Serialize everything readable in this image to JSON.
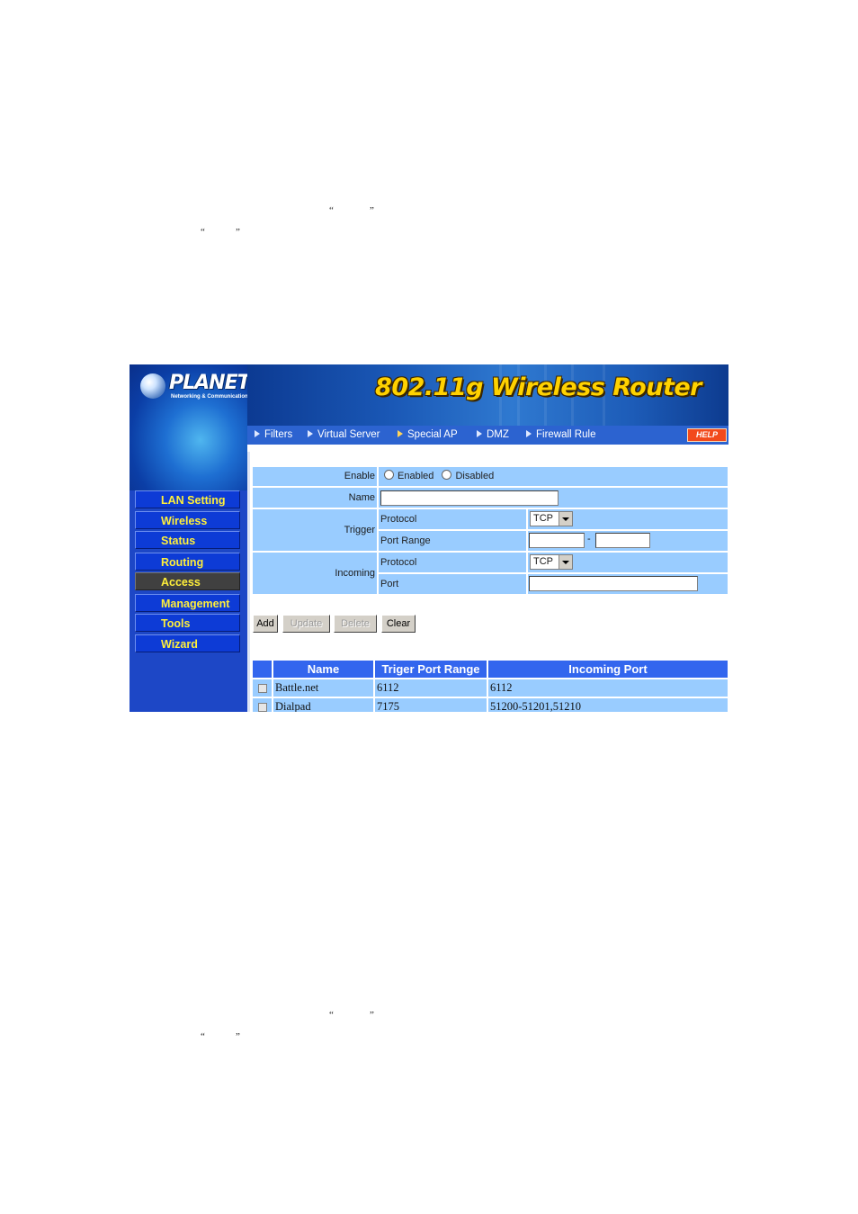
{
  "doc": {
    "quote_pairs": [
      {
        "open": "“",
        "close": "”"
      },
      {
        "open": "“",
        "close": "”"
      },
      {
        "open": "“",
        "close": "”"
      },
      {
        "open": "“",
        "close": "”"
      }
    ]
  },
  "header": {
    "logo_text": "PLANET",
    "logo_tagline": "Networking & Communication",
    "title": "802.11g Wireless Router"
  },
  "tabs": [
    {
      "label": "Filters",
      "active": false
    },
    {
      "label": "Virtual Server",
      "active": false
    },
    {
      "label": "Special AP",
      "active": true
    },
    {
      "label": "DMZ",
      "active": false
    },
    {
      "label": "Firewall Rule",
      "active": false
    }
  ],
  "help_label": "HELP",
  "sidebar": {
    "items": [
      {
        "label": "LAN Setting",
        "active": false
      },
      {
        "label": "Wireless",
        "active": false
      },
      {
        "label": "Status",
        "active": false
      },
      {
        "label": "Routing",
        "active": false
      },
      {
        "label": "Access",
        "active": true
      },
      {
        "label": "Management",
        "active": false
      },
      {
        "label": "Tools",
        "active": false
      },
      {
        "label": "Wizard",
        "active": false
      }
    ]
  },
  "form": {
    "enable_label": "Enable",
    "enabled_option": "Enabled",
    "disabled_option": "Disabled",
    "name_label": "Name",
    "name_value": "",
    "trigger_label": "Trigger",
    "trigger_protocol_label": "Protocol",
    "trigger_protocol_value": "TCP",
    "port_range_label": "Port Range",
    "port_range_from": "",
    "port_range_sep": "-",
    "port_range_to": "",
    "incoming_label": "Incoming",
    "incoming_protocol_label": "Protocol",
    "incoming_protocol_value": "TCP",
    "incoming_port_label": "Port",
    "incoming_port_value": ""
  },
  "buttons": {
    "add": "Add",
    "update": "Update",
    "delete": "Delete",
    "clear": "Clear"
  },
  "table": {
    "headers": [
      "Name",
      "Triger Port Range",
      "Incoming Port"
    ],
    "rows": [
      {
        "name": "Battle.net",
        "trigger": "6112",
        "incoming": "6112"
      },
      {
        "name": "Dialpad",
        "trigger": "7175",
        "incoming": "51200-51201,51210"
      }
    ]
  }
}
